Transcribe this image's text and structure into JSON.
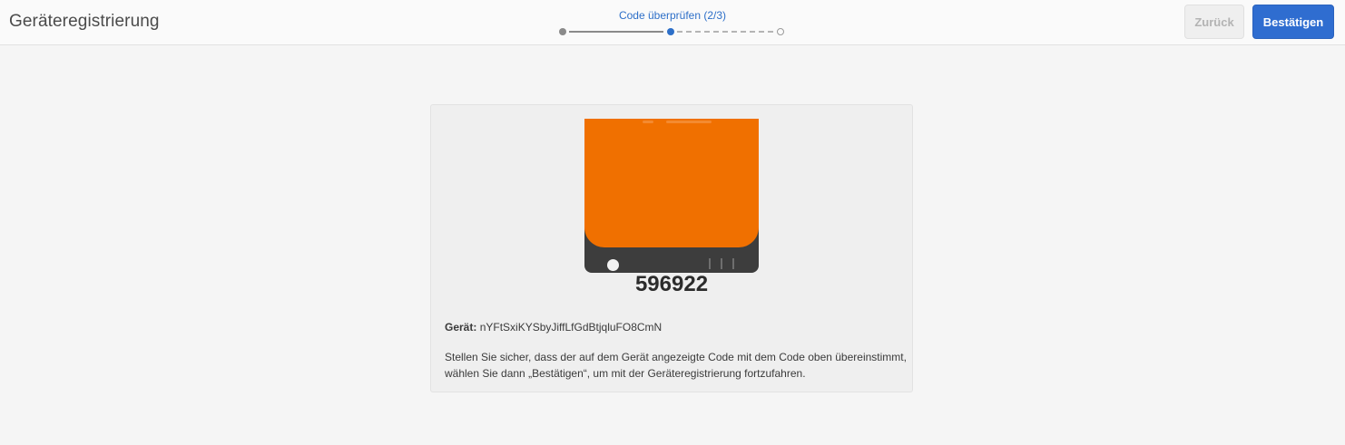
{
  "header": {
    "title": "Geräteregistrierung",
    "wizard": {
      "step_label": "Code überprüfen (2/3)",
      "current_step": 2,
      "total_steps": 3
    },
    "back_label": "Zurück",
    "confirm_label": "Bestätigen"
  },
  "card": {
    "device_icon": "mobile-device-icon",
    "code": "596922",
    "device_label": "Gerät:",
    "device_id": "nYFtSxiKYSbyJiffLfGdBtjqluFO8CmN",
    "info_line1": "Stellen Sie sicher, dass der auf dem Gerät angezeigte Code mit dem Code oben übereinstimmt,",
    "info_line2": "wählen Sie dann „Bestätigen“, um mit der Geräteregistrierung fortzufahren."
  },
  "colors": {
    "accent": "#2f6dd0",
    "device_screen": "#f07000",
    "device_body": "#3d3d3d"
  }
}
